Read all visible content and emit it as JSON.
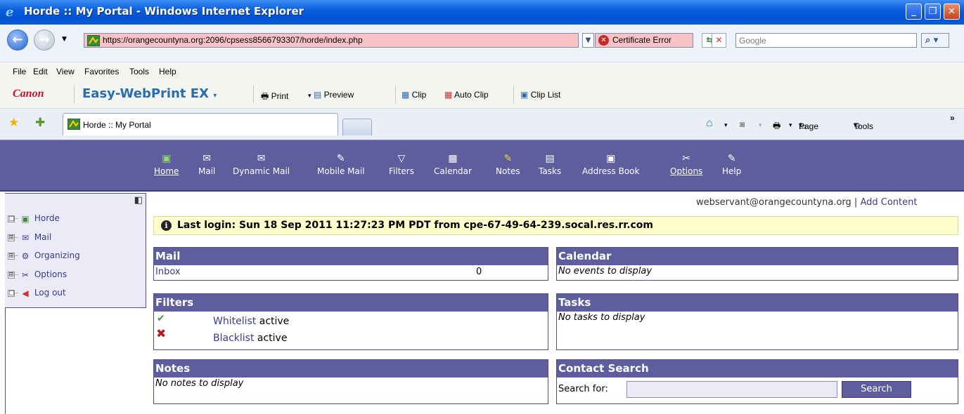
{
  "window": {
    "title": "Horde :: My Portal - Windows Internet Explorer"
  },
  "address": {
    "url": "https://orangecountyna.org:2096/cpsess8566793307/horde/index.php",
    "cert_error": "Certificate Error",
    "search_placeholder": "Google"
  },
  "menu": [
    "File",
    "Edit",
    "View",
    "Favorites",
    "Tools",
    "Help"
  ],
  "canon": {
    "brand": "Canon",
    "product": "Easy-WebPrint EX",
    "print": "Print",
    "preview": "Preview",
    "clip": "Clip",
    "auto_clip": "Auto Clip",
    "clip_list": "Clip List"
  },
  "tabs": {
    "active_title": "Horde :: My Portal"
  },
  "commandbar": {
    "page": "Page",
    "tools": "Tools"
  },
  "horde_nav": [
    {
      "label": "Home",
      "icon": "home-icon"
    },
    {
      "label": "Mail",
      "icon": "envelope-icon"
    },
    {
      "label": "Dynamic Mail",
      "icon": "envelope-icon"
    },
    {
      "label": "Mobile Mail",
      "icon": "phone-icon"
    },
    {
      "label": "Filters",
      "icon": "funnel-icon"
    },
    {
      "label": "Calendar",
      "icon": "calendar-icon"
    },
    {
      "label": "Notes",
      "icon": "note-icon"
    },
    {
      "label": "Tasks",
      "icon": "clipboard-icon"
    },
    {
      "label": "Address Book",
      "icon": "addressbook-icon"
    },
    {
      "label": "Options",
      "icon": "tools-icon"
    },
    {
      "label": "Help",
      "icon": "help-icon"
    }
  ],
  "sidebar": {
    "items": [
      {
        "label": "Horde",
        "expander": "□"
      },
      {
        "label": "Mail",
        "expander": "⊞"
      },
      {
        "label": "Organizing",
        "expander": "⊞"
      },
      {
        "label": "Options",
        "expander": "⊞"
      },
      {
        "label": "Log out",
        "expander": "□"
      }
    ]
  },
  "portal": {
    "user": "webservant@orangecountyna.org",
    "separator": "|",
    "add_content": "Add Content",
    "last_login": "Last login: Sun 18 Sep 2011 11:27:23 PM PDT from cpe-67-49-64-239.socal.res.rr.com",
    "mail": {
      "title": "Mail",
      "folder": "Inbox",
      "count": "0"
    },
    "calendar": {
      "title": "Calendar",
      "empty": "No events to display"
    },
    "filters": {
      "title": "Filters",
      "rows": [
        {
          "name": "Whitelist",
          "status": "active"
        },
        {
          "name": "Blacklist",
          "status": "active"
        }
      ]
    },
    "tasks": {
      "title": "Tasks",
      "empty": "No tasks to display"
    },
    "notes": {
      "title": "Notes",
      "empty": "No notes to display"
    },
    "contact_search": {
      "title": "Contact Search",
      "label": "Search for:",
      "button": "Search"
    }
  },
  "colors": {
    "horde_bar": "#5e5e9f",
    "sidebar_bg": "#ebebf7",
    "notice_bg": "#ffffcc",
    "url_error_bg": "#f7c3c6"
  }
}
